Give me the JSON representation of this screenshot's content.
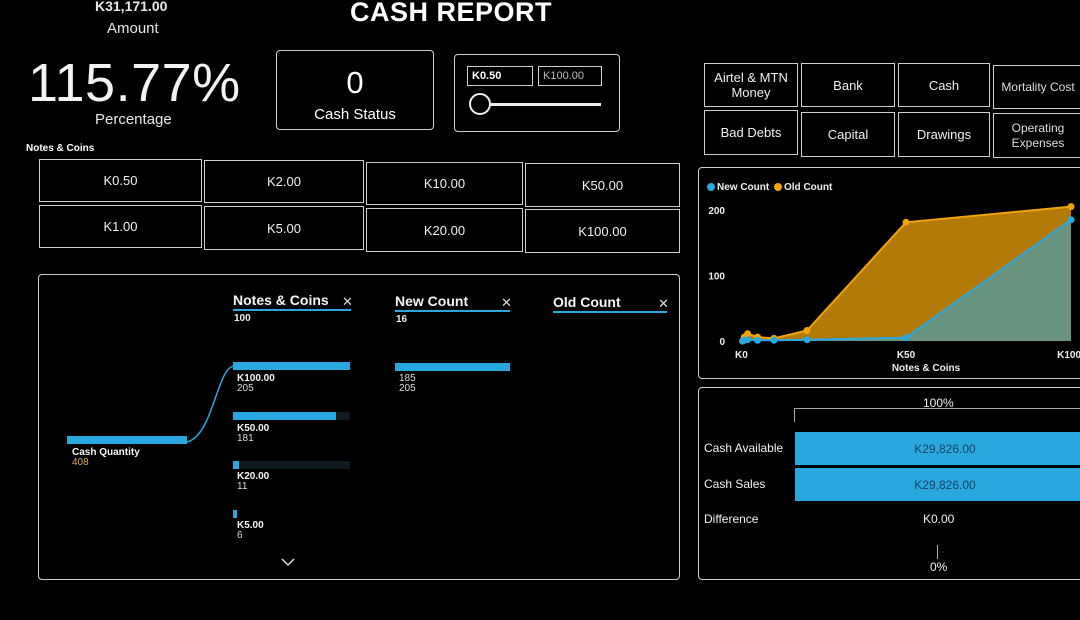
{
  "header": {
    "amount_value": "K31,171.00",
    "amount_label": "Amount",
    "title": "CASH REPORT",
    "percentage_value": "115.77%",
    "percentage_label": "Percentage"
  },
  "cash_status": {
    "value": "0",
    "label": "Cash Status"
  },
  "slicer": {
    "min": "K0.50",
    "max": "K100.00",
    "level": 0
  },
  "categories": [
    [
      "Airtel & MTN",
      "Money"
    ],
    [
      "Bank"
    ],
    [
      "Cash"
    ],
    [
      "Mortality Cost"
    ],
    [
      "Bad Debts"
    ],
    [
      "Capital"
    ],
    [
      "Drawings"
    ],
    [
      "Operating",
      "Expenses"
    ]
  ],
  "notes_coins": {
    "label": "Notes & Coins",
    "denominations": [
      "K0.50",
      "K2.00",
      "K10.00",
      "K50.00",
      "K1.00",
      "K5.00",
      "K20.00",
      "K100.00"
    ]
  },
  "tree": {
    "columns": [
      {
        "name": "Notes & Coins",
        "sub": "100"
      },
      {
        "name": "New Count",
        "sub": "16"
      },
      {
        "name": "Old Count",
        "sub": ""
      }
    ],
    "root": {
      "label": "Cash Quantity",
      "value": "408"
    },
    "nodes": [
      {
        "label": "K100.00",
        "value": "205",
        "fraction": 1.0
      },
      {
        "label": "K50.00",
        "value": "181",
        "fraction": 0.883
      },
      {
        "label": "K20.00",
        "value": "11",
        "fraction": 0.054
      },
      {
        "label": "K5.00",
        "value": "6",
        "fraction": 0.03
      }
    ],
    "new_count_node": {
      "value": "185",
      "total": "205",
      "fraction": 1.0
    },
    "expand_icon": "chevron-down-icon"
  },
  "chart_data": {
    "type": "area",
    "series": [
      {
        "name": "New Count",
        "color": "#29a8e0",
        "values": [
          0,
          1,
          2,
          1,
          1,
          2,
          5,
          185
        ]
      },
      {
        "name": "Old Count",
        "color": "#f0a30a",
        "values": [
          0,
          6,
          11,
          6,
          4,
          16,
          181,
          205
        ]
      }
    ],
    "x": [
      0.5,
      1,
      2,
      5,
      10,
      20,
      50,
      100
    ],
    "xlabel": "Notes & Coins",
    "x_tick_labels": [
      "K0",
      "K50",
      "K100"
    ],
    "y_ticks": [
      0,
      100,
      200
    ],
    "ylim": [
      0,
      215
    ],
    "xlim": [
      0,
      100
    ],
    "legend_position": "top-left"
  },
  "kpi": {
    "top_scale": "100%",
    "bottom_scale": "0%",
    "rows": [
      {
        "label": "Cash Available",
        "value": "K29,826.00"
      },
      {
        "label": "Cash Sales",
        "value": "K29,826.00"
      },
      {
        "label": "Difference",
        "value": "K0.00"
      }
    ],
    "accent": "#29a8e0"
  }
}
